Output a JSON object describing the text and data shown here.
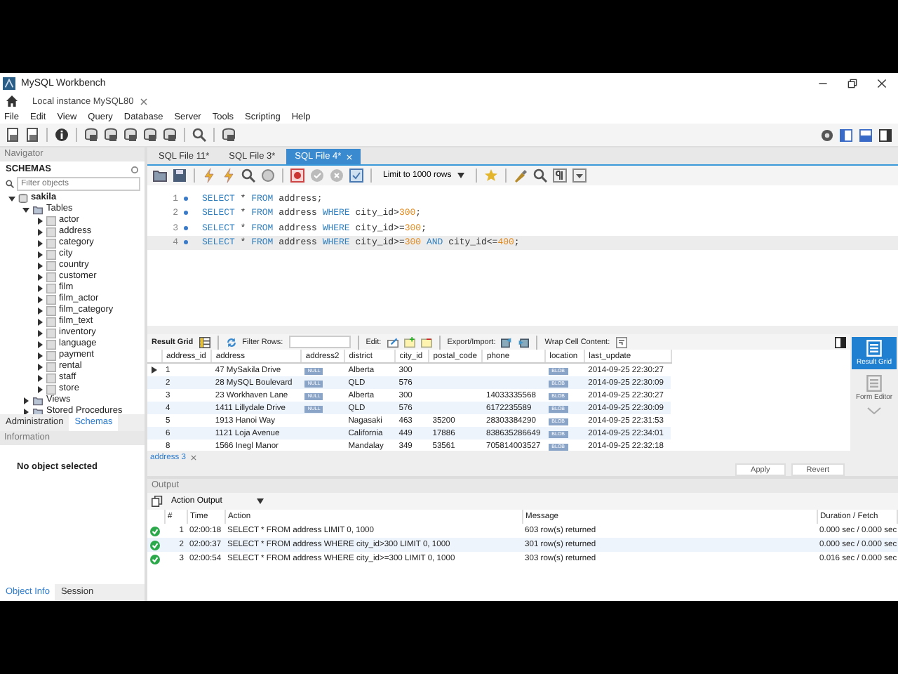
{
  "window": {
    "title": "MySQL Workbench"
  },
  "connection_tab": {
    "label": "Local instance MySQL80"
  },
  "menu": [
    "File",
    "Edit",
    "View",
    "Query",
    "Database",
    "Server",
    "Tools",
    "Scripting",
    "Help"
  ],
  "navigator": {
    "title": "Navigator",
    "section": "SCHEMAS",
    "filter_placeholder": "Filter objects",
    "tree": [
      {
        "label": "sakila",
        "kind": "schema",
        "expanded": true,
        "children": [
          {
            "label": "Tables",
            "kind": "folder",
            "expanded": true,
            "children": [
              {
                "label": "actor",
                "kind": "table",
                "expanded": false
              },
              {
                "label": "address",
                "kind": "table",
                "expanded": false
              },
              {
                "label": "category",
                "kind": "table",
                "expanded": false
              },
              {
                "label": "city",
                "kind": "table",
                "expanded": false
              },
              {
                "label": "country",
                "kind": "table",
                "expanded": false
              },
              {
                "label": "customer",
                "kind": "table",
                "expanded": false
              },
              {
                "label": "film",
                "kind": "table",
                "expanded": false
              },
              {
                "label": "film_actor",
                "kind": "table",
                "expanded": false
              },
              {
                "label": "film_category",
                "kind": "table",
                "expanded": false
              },
              {
                "label": "film_text",
                "kind": "table",
                "expanded": false
              },
              {
                "label": "inventory",
                "kind": "table",
                "expanded": false
              },
              {
                "label": "language",
                "kind": "table",
                "expanded": false
              },
              {
                "label": "payment",
                "kind": "table",
                "expanded": false
              },
              {
                "label": "rental",
                "kind": "table",
                "expanded": false
              },
              {
                "label": "staff",
                "kind": "table",
                "expanded": false
              },
              {
                "label": "store",
                "kind": "table",
                "expanded": false
              }
            ]
          },
          {
            "label": "Views",
            "kind": "folder",
            "expanded": false
          },
          {
            "label": "Stored Procedures",
            "kind": "folder",
            "expanded": false
          }
        ]
      }
    ],
    "tabs": [
      {
        "label": "Administration",
        "selected": false
      },
      {
        "label": "Schemas",
        "selected": true
      }
    ]
  },
  "information": {
    "title": "Information",
    "message": "No object selected",
    "tabs": [
      {
        "label": "Object Info",
        "selected": true
      },
      {
        "label": "Session",
        "selected": false
      }
    ]
  },
  "sql_tabs": [
    {
      "label": "SQL File 11*",
      "selected": false
    },
    {
      "label": "SQL File 3*",
      "selected": false
    },
    {
      "label": "SQL File 4*",
      "selected": true
    }
  ],
  "limit_select": {
    "value": "Limit to 1000 rows"
  },
  "editor": {
    "lines": [
      {
        "number": "1",
        "current": false,
        "tokens": [
          {
            "text": "SELECT",
            "kind": "keyword"
          },
          {
            "text": " * ",
            "kind": "plain"
          },
          {
            "text": "FROM",
            "kind": "keyword"
          },
          {
            "text": " address;",
            "kind": "plain"
          }
        ]
      },
      {
        "number": "2",
        "current": false,
        "tokens": [
          {
            "text": "SELECT",
            "kind": "keyword"
          },
          {
            "text": " * ",
            "kind": "plain"
          },
          {
            "text": "FROM",
            "kind": "keyword"
          },
          {
            "text": " address ",
            "kind": "plain"
          },
          {
            "text": "WHERE",
            "kind": "keyword"
          },
          {
            "text": " city_id>",
            "kind": "plain"
          },
          {
            "text": "300",
            "kind": "number"
          },
          {
            "text": ";",
            "kind": "plain"
          }
        ]
      },
      {
        "number": "3",
        "current": false,
        "tokens": [
          {
            "text": "SELECT",
            "kind": "keyword"
          },
          {
            "text": " * ",
            "kind": "plain"
          },
          {
            "text": "FROM",
            "kind": "keyword"
          },
          {
            "text": " address ",
            "kind": "plain"
          },
          {
            "text": "WHERE",
            "kind": "keyword"
          },
          {
            "text": " city_id>=",
            "kind": "plain"
          },
          {
            "text": "300",
            "kind": "number"
          },
          {
            "text": ";",
            "kind": "plain"
          }
        ]
      },
      {
        "number": "4",
        "current": true,
        "tokens": [
          {
            "text": "SELECT",
            "kind": "keyword"
          },
          {
            "text": " * ",
            "kind": "plain"
          },
          {
            "text": "FROM",
            "kind": "keyword"
          },
          {
            "text": " address ",
            "kind": "plain"
          },
          {
            "text": "WHERE",
            "kind": "keyword"
          },
          {
            "text": " city_id>=",
            "kind": "plain"
          },
          {
            "text": "300",
            "kind": "number"
          },
          {
            "text": " AND",
            "kind": "keyword"
          },
          {
            "text": " city_id<=",
            "kind": "plain"
          },
          {
            "text": "400",
            "kind": "number"
          },
          {
            "text": ";",
            "kind": "plain"
          }
        ]
      }
    ]
  },
  "result_toolbar": {
    "view_label": "Result Grid",
    "filter_label": "Filter Rows:",
    "edit_label": "Edit:",
    "export_label": "Export/Import:",
    "wrap_label": "Wrap Cell Content:"
  },
  "grid": {
    "columns": [
      "address_id",
      "address",
      "address2",
      "district",
      "city_id",
      "postal_code",
      "phone",
      "location",
      "last_update"
    ],
    "rows": [
      {
        "current": true,
        "cells": [
          {
            "kind": "text",
            "text": "1"
          },
          {
            "kind": "text",
            "text": "47 MySakila Drive"
          },
          {
            "kind": "badge",
            "text": "NULL"
          },
          {
            "kind": "text",
            "text": "Alberta"
          },
          {
            "kind": "text",
            "text": "300"
          },
          {
            "kind": "blank"
          },
          {
            "kind": "blank"
          },
          {
            "kind": "badge",
            "text": "BLOB"
          },
          {
            "kind": "text",
            "text": "2014-09-25 22:30:27"
          }
        ]
      },
      {
        "current": false,
        "cells": [
          {
            "kind": "text",
            "text": "2"
          },
          {
            "kind": "text",
            "text": "28 MySQL Boulevard"
          },
          {
            "kind": "badge",
            "text": "NULL"
          },
          {
            "kind": "text",
            "text": "QLD"
          },
          {
            "kind": "text",
            "text": "576"
          },
          {
            "kind": "blank"
          },
          {
            "kind": "blank"
          },
          {
            "kind": "badge",
            "text": "BLOB"
          },
          {
            "kind": "text",
            "text": "2014-09-25 22:30:09"
          }
        ]
      },
      {
        "current": false,
        "cells": [
          {
            "kind": "text",
            "text": "3"
          },
          {
            "kind": "text",
            "text": "23 Workhaven Lane"
          },
          {
            "kind": "badge",
            "text": "NULL"
          },
          {
            "kind": "text",
            "text": "Alberta"
          },
          {
            "kind": "text",
            "text": "300"
          },
          {
            "kind": "blank"
          },
          {
            "kind": "text",
            "text": "14033335568"
          },
          {
            "kind": "badge",
            "text": "BLOB"
          },
          {
            "kind": "text",
            "text": "2014-09-25 22:30:27"
          }
        ]
      },
      {
        "current": false,
        "cells": [
          {
            "kind": "text",
            "text": "4"
          },
          {
            "kind": "text",
            "text": "1411 Lillydale Drive"
          },
          {
            "kind": "badge",
            "text": "NULL"
          },
          {
            "kind": "text",
            "text": "QLD"
          },
          {
            "kind": "text",
            "text": "576"
          },
          {
            "kind": "blank"
          },
          {
            "kind": "text",
            "text": "6172235589"
          },
          {
            "kind": "badge",
            "text": "BLOB"
          },
          {
            "kind": "text",
            "text": "2014-09-25 22:30:09"
          }
        ]
      },
      {
        "current": false,
        "cells": [
          {
            "kind": "text",
            "text": "5"
          },
          {
            "kind": "text",
            "text": "1913 Hanoi Way"
          },
          {
            "kind": "blank"
          },
          {
            "kind": "text",
            "text": "Nagasaki"
          },
          {
            "kind": "text",
            "text": "463"
          },
          {
            "kind": "text",
            "text": "35200"
          },
          {
            "kind": "text",
            "text": "28303384290"
          },
          {
            "kind": "badge",
            "text": "BLOB"
          },
          {
            "kind": "text",
            "text": "2014-09-25 22:31:53"
          }
        ]
      },
      {
        "current": false,
        "cells": [
          {
            "kind": "text",
            "text": "6"
          },
          {
            "kind": "text",
            "text": "1121 Loja Avenue"
          },
          {
            "kind": "blank"
          },
          {
            "kind": "text",
            "text": "California"
          },
          {
            "kind": "text",
            "text": "449"
          },
          {
            "kind": "text",
            "text": "17886"
          },
          {
            "kind": "text",
            "text": "838635286649"
          },
          {
            "kind": "badge",
            "text": "BLOB"
          },
          {
            "kind": "text",
            "text": "2014-09-25 22:34:01"
          }
        ]
      },
      {
        "current": false,
        "cells": [
          {
            "kind": "text",
            "text": "8"
          },
          {
            "kind": "text",
            "text": "1566 Inegl Manor"
          },
          {
            "kind": "blank"
          },
          {
            "kind": "text",
            "text": "Mandalay"
          },
          {
            "kind": "text",
            "text": "349"
          },
          {
            "kind": "text",
            "text": "53561"
          },
          {
            "kind": "text",
            "text": "705814003527"
          },
          {
            "kind": "badge",
            "text": "BLOB"
          },
          {
            "kind": "text",
            "text": "2014-09-25 22:32:18"
          }
        ]
      }
    ]
  },
  "result_tab": {
    "label": "address 3"
  },
  "side_panel": [
    {
      "label": "Result Grid",
      "selected": true
    },
    {
      "label": "Form Editor",
      "selected": false
    }
  ],
  "edit_buttons": [
    "Apply",
    "Revert"
  ],
  "output": {
    "title": "Output",
    "select": "Action Output",
    "columns": [
      "#",
      "Time",
      "Action",
      "Message",
      "Duration / Fetch"
    ],
    "rows": [
      {
        "kind": "success",
        "number": "1",
        "time": "02:00:18",
        "action": "SELECT * FROM address LIMIT 0, 1000",
        "message": "603 row(s) returned",
        "duration": "0.000 sec / 0.000 sec"
      },
      {
        "kind": "success",
        "number": "2",
        "time": "02:00:37",
        "action": "SELECT * FROM address WHERE city_id>300 LIMIT 0, 1000",
        "message": "301 row(s) returned",
        "duration": "0.000 sec / 0.000 sec"
      },
      {
        "kind": "success",
        "number": "3",
        "time": "02:00:54",
        "action": "SELECT * FROM address WHERE city_id>=300 LIMIT 0, 1000",
        "message": "303 row(s) returned",
        "duration": "0.016 sec / 0.000 sec"
      }
    ]
  }
}
